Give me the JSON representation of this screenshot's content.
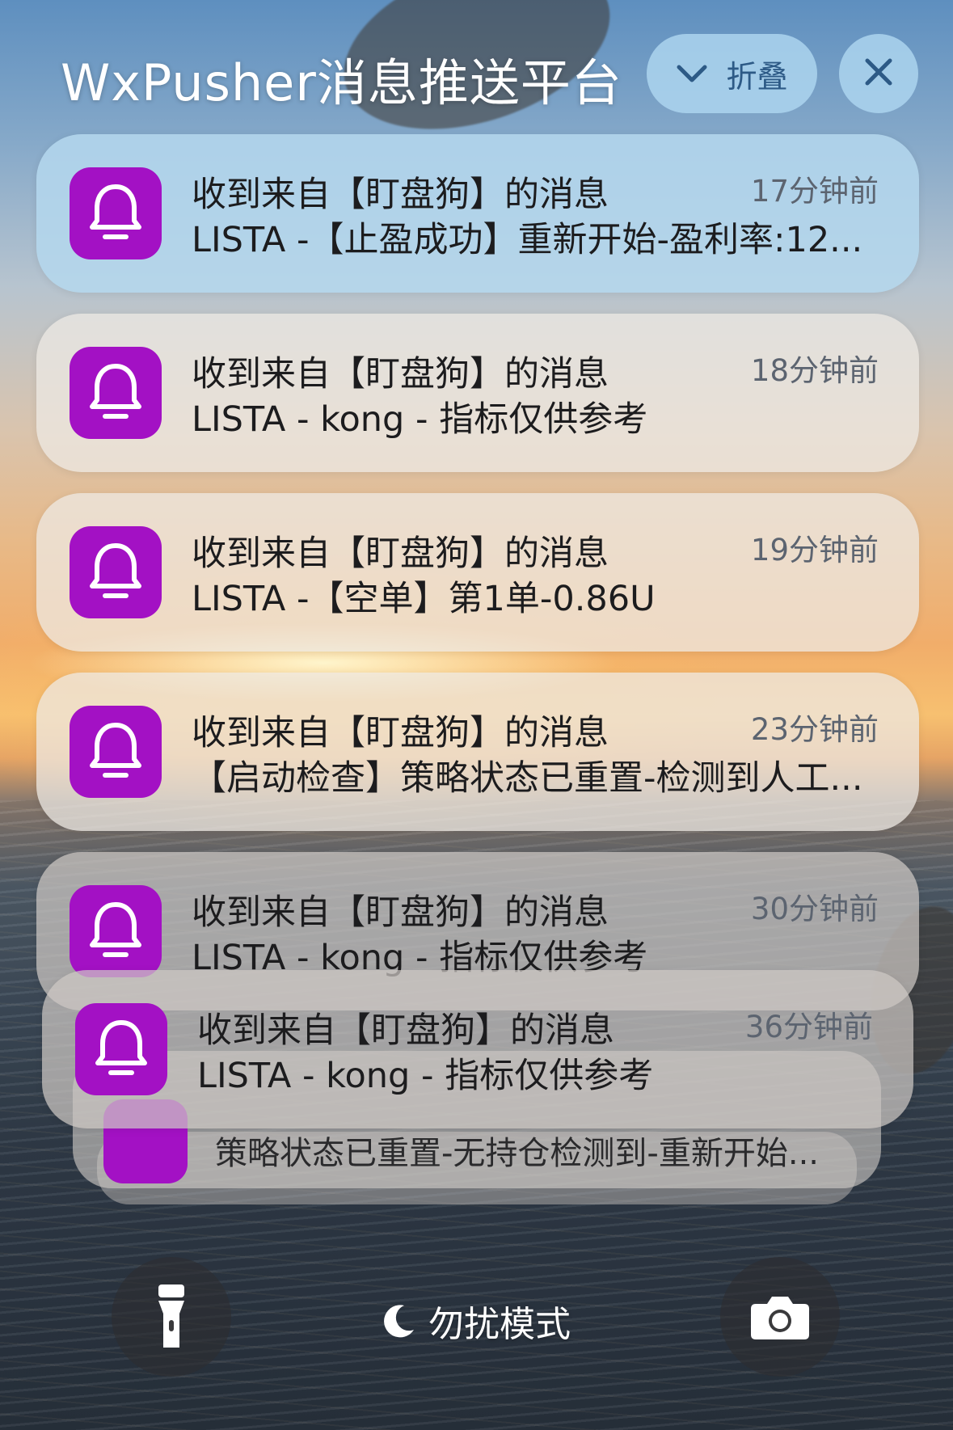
{
  "header": {
    "title": "WxPusher消息推送平台",
    "collapse_label": "折叠"
  },
  "notifications": [
    {
      "title": "收到来自【盯盘狗】的消息",
      "body": "LISTA -【止盈成功】重新开始-盈利率:12...",
      "time": "17分钟前"
    },
    {
      "title": "收到来自【盯盘狗】的消息",
      "body": "LISTA - kong - 指标仅供参考",
      "time": "18分钟前"
    },
    {
      "title": "收到来自【盯盘狗】的消息",
      "body": "LISTA -【空单】第1单-0.86U",
      "time": "19分钟前"
    },
    {
      "title": "收到来自【盯盘狗】的消息",
      "body": "【启动检查】策略状态已重置-检测到人工...",
      "time": "23分钟前"
    },
    {
      "title": "收到来自【盯盘狗】的消息",
      "body": "LISTA - kong - 指标仅供参考",
      "time": "30分钟前"
    },
    {
      "title": "收到来自【盯盘狗】的消息",
      "body": "LISTA - kong - 指标仅供参考",
      "time": "36分钟前"
    }
  ],
  "stacked": {
    "body": "策略状态已重置-无持仓检测到-重新开始..."
  },
  "bottom": {
    "dnd_label": "勿扰模式"
  },
  "colors": {
    "app_icon": "#a311c4",
    "accent_blue": "#2d5a86"
  },
  "icons": {
    "app": "bell-icon",
    "collapse": "chevron-down-icon",
    "close": "close-icon",
    "flashlight": "flashlight-icon",
    "camera": "camera-icon",
    "dnd": "moon-icon"
  }
}
